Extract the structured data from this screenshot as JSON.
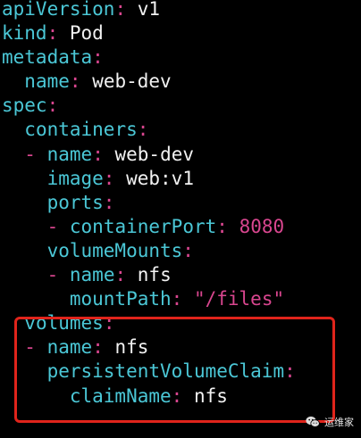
{
  "lines": [
    {
      "indent": "",
      "dash": "",
      "key": "apiVersion",
      "colon": ":",
      "value": "v1",
      "value_type": "plain"
    },
    {
      "indent": "",
      "dash": "",
      "key": "kind",
      "colon": ":",
      "value": "Pod",
      "value_type": "plain"
    },
    {
      "indent": "",
      "dash": "",
      "key": "metadata",
      "colon": ":",
      "value": "",
      "value_type": "plain"
    },
    {
      "indent": "  ",
      "dash": "",
      "key": "name",
      "colon": ":",
      "value": "web-dev",
      "value_type": "plain"
    },
    {
      "indent": "",
      "dash": "",
      "key": "spec",
      "colon": ":",
      "value": "",
      "value_type": "plain"
    },
    {
      "indent": "  ",
      "dash": "",
      "key": "containers",
      "colon": ":",
      "value": "",
      "value_type": "plain"
    },
    {
      "indent": "  ",
      "dash": "-",
      "key": "name",
      "colon": ":",
      "value": "web-dev",
      "value_type": "plain"
    },
    {
      "indent": "    ",
      "dash": "",
      "key": "image",
      "colon": ":",
      "value": "web:v1",
      "value_type": "plain"
    },
    {
      "indent": "    ",
      "dash": "",
      "key": "ports",
      "colon": ":",
      "value": "",
      "value_type": "plain"
    },
    {
      "indent": "    ",
      "dash": "-",
      "key": "containerPort",
      "colon": ":",
      "value": "8080",
      "value_type": "number"
    },
    {
      "indent": "    ",
      "dash": "",
      "key": "volumeMounts",
      "colon": ":",
      "value": "",
      "value_type": "plain"
    },
    {
      "indent": "    ",
      "dash": "-",
      "key": "name",
      "colon": ":",
      "value": "nfs",
      "value_type": "plain"
    },
    {
      "indent": "      ",
      "dash": "",
      "key": "mountPath",
      "colon": ":",
      "value": "\"/files\"",
      "value_type": "string"
    },
    {
      "indent": "  ",
      "dash": "",
      "key": "volumes",
      "colon": ":",
      "value": "",
      "value_type": "plain"
    },
    {
      "indent": "  ",
      "dash": "-",
      "key": "name",
      "colon": ":",
      "value": "nfs",
      "value_type": "plain"
    },
    {
      "indent": "    ",
      "dash": "",
      "key": "persistentVolumeClaim",
      "colon": ":",
      "value": "",
      "value_type": "plain"
    },
    {
      "indent": "      ",
      "dash": "",
      "key": "claimName",
      "colon": ":",
      "value": "nfs",
      "value_type": "plain"
    }
  ],
  "watermark": {
    "text": "运维家",
    "icon": "wechat-icon"
  },
  "colors": {
    "background": "#000000",
    "key": "#4bc7d6",
    "punctuation": "#d9468f",
    "value": "#f2f2f2",
    "highlight": "#e0241b"
  }
}
